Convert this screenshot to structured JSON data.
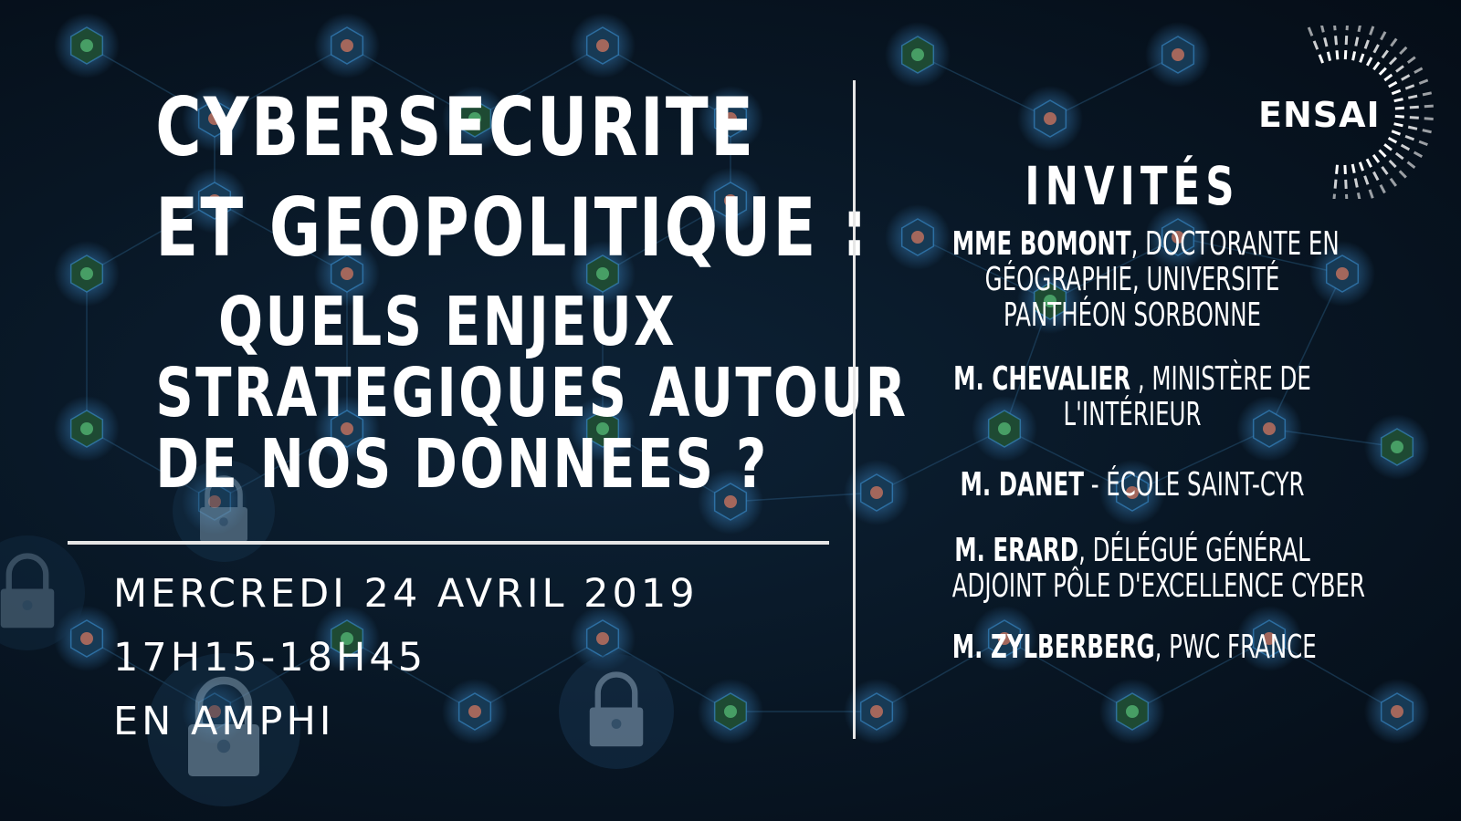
{
  "title": {
    "line1": "CYBERSECURITE",
    "line2": "ET GEOPOLITIQUE :",
    "line3": "QUELS ENJEUX",
    "line4": "STRATEGIQUES AUTOUR",
    "line5": "DE NOS DONNEES ?"
  },
  "event": {
    "date": "MERCREDI 24 AVRIL 2019",
    "time": "17H15-18H45",
    "place": "EN AMPHI"
  },
  "guests": {
    "heading": "INVITÉS",
    "items": [
      {
        "name": "MME BOMONT",
        "lines": [
          ", DOCTORANTE EN",
          "GÉOGRAPHIE, UNIVERSITÉ",
          "PANTHÉON SORBONNE"
        ]
      },
      {
        "name": "M. CHEVALIER",
        "lines": [
          " , MINISTÈRE DE",
          "L'INTÉRIEUR"
        ]
      },
      {
        "name": "M. DANET",
        "lines": [
          " - ÉCOLE SAINT-CYR"
        ]
      },
      {
        "name": "M. ERARD",
        "lines": [
          ", DÉLÉGUÉ GÉNÉRAL",
          "ADJOINT PÔLE D'EXCELLENCE CYBER"
        ]
      },
      {
        "name": "M. ZYLBERBERG",
        "lines": [
          ", PWC FRANCE"
        ]
      }
    ]
  },
  "logo": {
    "text": "ENSAI"
  },
  "colors": {
    "background": "#081624",
    "text": "#ffffff",
    "accent": "#3b8fd0",
    "node_glow": "#2f7a4a"
  },
  "icons": [
    "padlock-icon",
    "hexagon-network-icon"
  ]
}
